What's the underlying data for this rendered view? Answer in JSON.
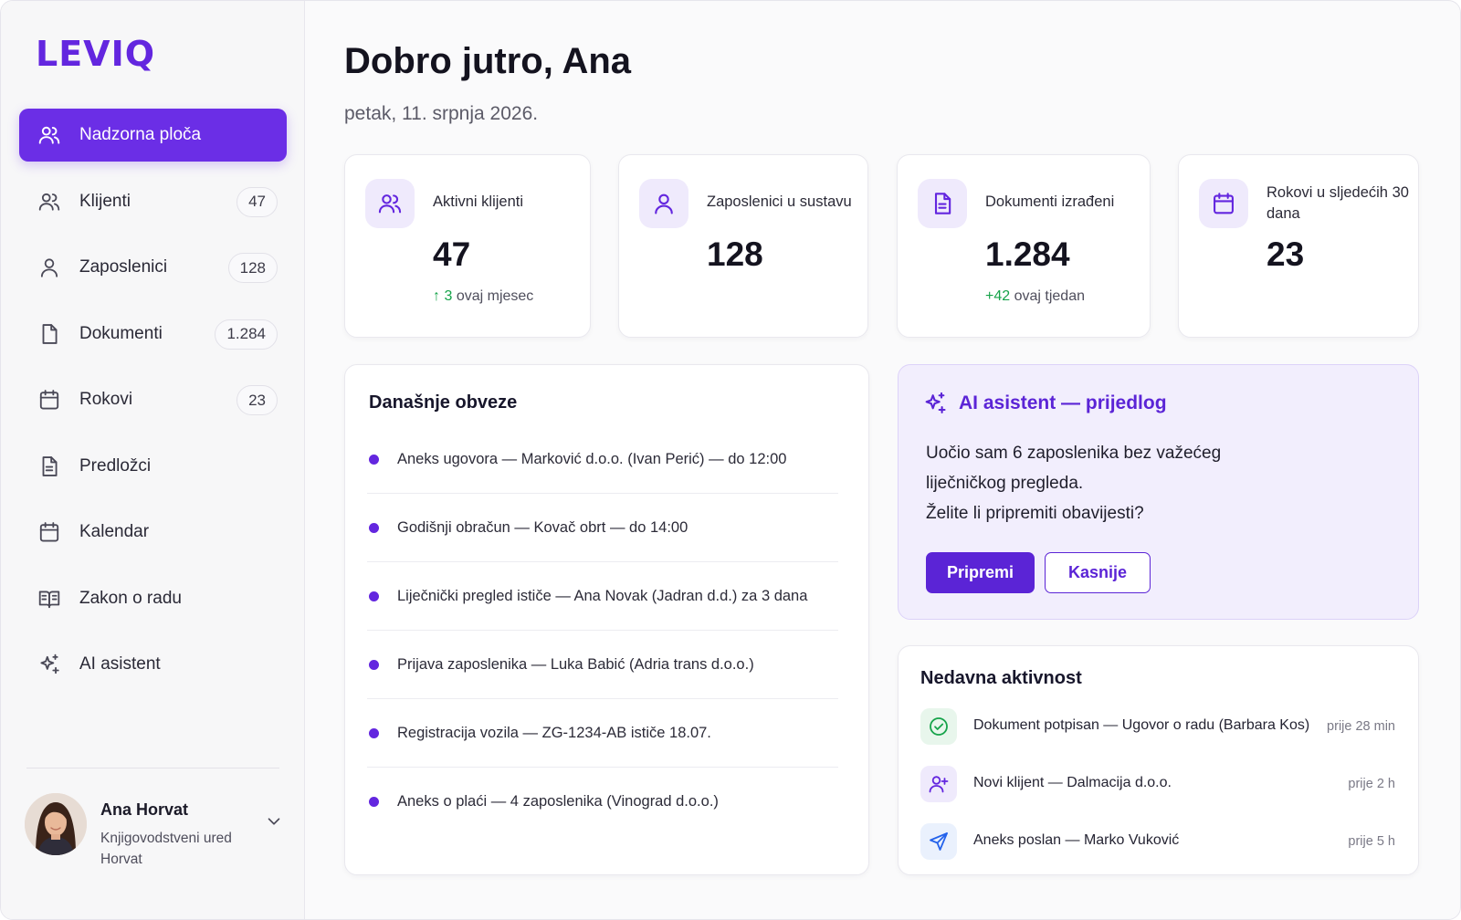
{
  "brand": {
    "logo": "LEVIQ",
    "accent": "#6b2ee6"
  },
  "sidebar": {
    "items": [
      {
        "label": "Nadzorna ploča",
        "icon": "users-icon",
        "badge": null,
        "active": true
      },
      {
        "label": "Klijenti",
        "icon": "users-icon",
        "badge": "47",
        "active": false
      },
      {
        "label": "Zaposlenici",
        "icon": "user-icon",
        "badge": "128",
        "active": false
      },
      {
        "label": "Dokumenti",
        "icon": "file-icon",
        "badge": "1.284",
        "active": false
      },
      {
        "label": "Rokovi",
        "icon": "calendar-icon",
        "badge": "23",
        "active": false
      },
      {
        "label": "Predložci",
        "icon": "file-text-icon",
        "badge": null,
        "active": false
      },
      {
        "label": "Kalendar",
        "icon": "calendar-icon",
        "badge": null,
        "active": false
      },
      {
        "label": "Zakon o radu",
        "icon": "book-open-icon",
        "badge": null,
        "active": false
      },
      {
        "label": "AI asistent",
        "icon": "sparkles-icon",
        "badge": null,
        "active": false
      }
    ],
    "user": {
      "name": "Ana Horvat",
      "org": "Knjigovodstveni ured Horvat"
    }
  },
  "header": {
    "greeting": "Dobro jutro, Ana",
    "date": "petak, 11. srpnja 2026."
  },
  "stats": [
    {
      "label": "Aktivni klijenti",
      "value": "47",
      "delta_value": "3",
      "delta_text": "ovaj mjesec",
      "delta_arrow": "↑",
      "icon": "users-icon"
    },
    {
      "label": "Zaposlenici u sustavu",
      "value": "128",
      "delta_value": "",
      "delta_text": "",
      "icon": "user-icon"
    },
    {
      "label": "Dokumenti izrađeni",
      "value": "1.284",
      "delta_value": "+42",
      "delta_text": "ovaj tjedan",
      "icon": "file-text-icon"
    },
    {
      "label": "Rokovi u sljedećih 30 dana",
      "value": "23",
      "delta_value": "",
      "delta_text": "",
      "icon": "calendar-icon"
    }
  ],
  "obligations": {
    "title": "Današnje obveze",
    "items": [
      "Aneks ugovora — Marković d.o.o. (Ivan Perić) — do 12:00",
      "Godišnji obračun — Kovač obrt — do 14:00",
      "Liječnički pregled ističe — Ana Novak (Jadran d.d.) za 3 dana",
      "Prijava zaposlenika — Luka Babić (Adria trans d.o.o.)",
      "Registracija vozila — ZG-1234-AB ističe 18.07.",
      "Aneks o plaći — 4 zaposlenika (Vinograd d.o.o.)"
    ]
  },
  "ai": {
    "title": "AI asistent — prijedlog",
    "message": "Uočio sam 6 zaposlenika bez važećeg liječničkog pregleda.",
    "question": "Želite li pripremiti obavijesti?",
    "primary_label": "Pripremi",
    "secondary_label": "Kasnije"
  },
  "activity": {
    "title": "Nedavna aktivnost",
    "items": [
      {
        "text": "Dokument potpisan — Ugovor o radu (Barbara Kos)",
        "time": "prije 28 min",
        "icon": "check-circle-icon",
        "color": "#16a34a"
      },
      {
        "text": "Novi klijent — Dalmacija d.o.o.",
        "time": "prije 2 h",
        "icon": "user-plus-icon",
        "color": "#6326df"
      },
      {
        "text": "Aneks poslan — Marko Vuković",
        "time": "prije 5 h",
        "icon": "send-icon",
        "color": "#2563eb"
      }
    ]
  }
}
